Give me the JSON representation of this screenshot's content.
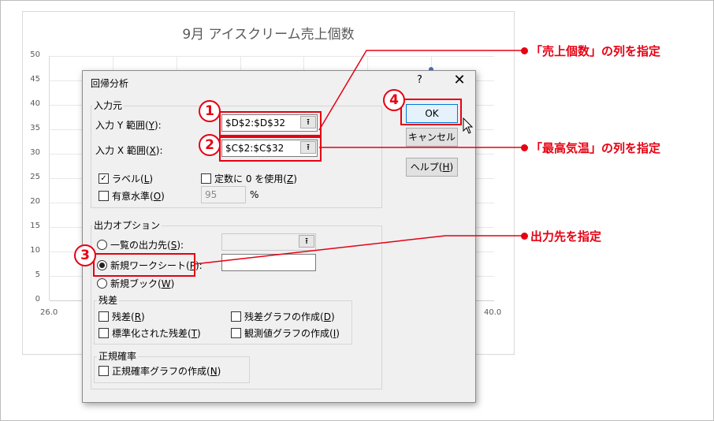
{
  "chart": {
    "title": "9月 アイスクリーム売上個数",
    "y_ticks": [
      "50",
      "45",
      "40",
      "35",
      "30",
      "25",
      "20",
      "15",
      "10",
      "5",
      "0"
    ],
    "x_ticks": [
      "26.0",
      "40.0"
    ]
  },
  "dialog": {
    "title": "回帰分析",
    "help_button": "?",
    "close_button": "✕",
    "input_group": "入力元",
    "y_range": {
      "label": "入力 Y 範囲(",
      "key": "Y",
      "suffix": "):",
      "value": "$D$2:$D$32"
    },
    "x_range": {
      "label": "入力 X 範囲(",
      "key": "X",
      "suffix": "):",
      "value": "$C$2:$C$32"
    },
    "label_cb": {
      "label": "ラベル(",
      "key": "L",
      "suffix": ")",
      "checked": true
    },
    "constant_cb": {
      "label": "定数に 0 を使用(",
      "key": "Z",
      "suffix": ")",
      "checked": false
    },
    "confidence_cb": {
      "label": "有意水準(",
      "key": "O",
      "suffix": ")",
      "checked": false
    },
    "confidence_value": "95",
    "percent": "%",
    "ok": "OK",
    "cancel": "キャンセル",
    "help": {
      "label": "ヘルプ(",
      "key": "H",
      "suffix": ")"
    },
    "output_group": "出力オプション",
    "output_range": {
      "label": "一覧の出力先(",
      "key": "S",
      "suffix": "):",
      "selected": false
    },
    "new_sheet": {
      "label": "新規ワークシート(",
      "key": "P",
      "suffix": "):",
      "selected": true
    },
    "new_book": {
      "label": "新規ブック(",
      "key": "W",
      "suffix": ")",
      "selected": false
    },
    "residuals_group": "残差",
    "residuals": {
      "label": "残差(",
      "key": "R",
      "suffix": ")"
    },
    "residual_plots": {
      "label": "残差グラフの作成(",
      "key": "D",
      "suffix": ")"
    },
    "std_residuals": {
      "label": "標準化された残差(",
      "key": "T",
      "suffix": ")"
    },
    "line_fit": {
      "label": "観測値グラフの作成(",
      "key": "I",
      "suffix": ")"
    },
    "normal_group": "正規確率",
    "normal_plot": {
      "label": "正規確率グラフの作成(",
      "key": "N",
      "suffix": ")"
    },
    "ref_button_glyph": "⭱"
  },
  "annotations": {
    "step1": "1",
    "step2": "2",
    "step3": "3",
    "step4": "4",
    "callout1": "「売上個数」の列を指定",
    "callout2": "「最高気温」の列を指定",
    "callout3": "出力先を指定",
    "accent_color": "#e60012"
  }
}
